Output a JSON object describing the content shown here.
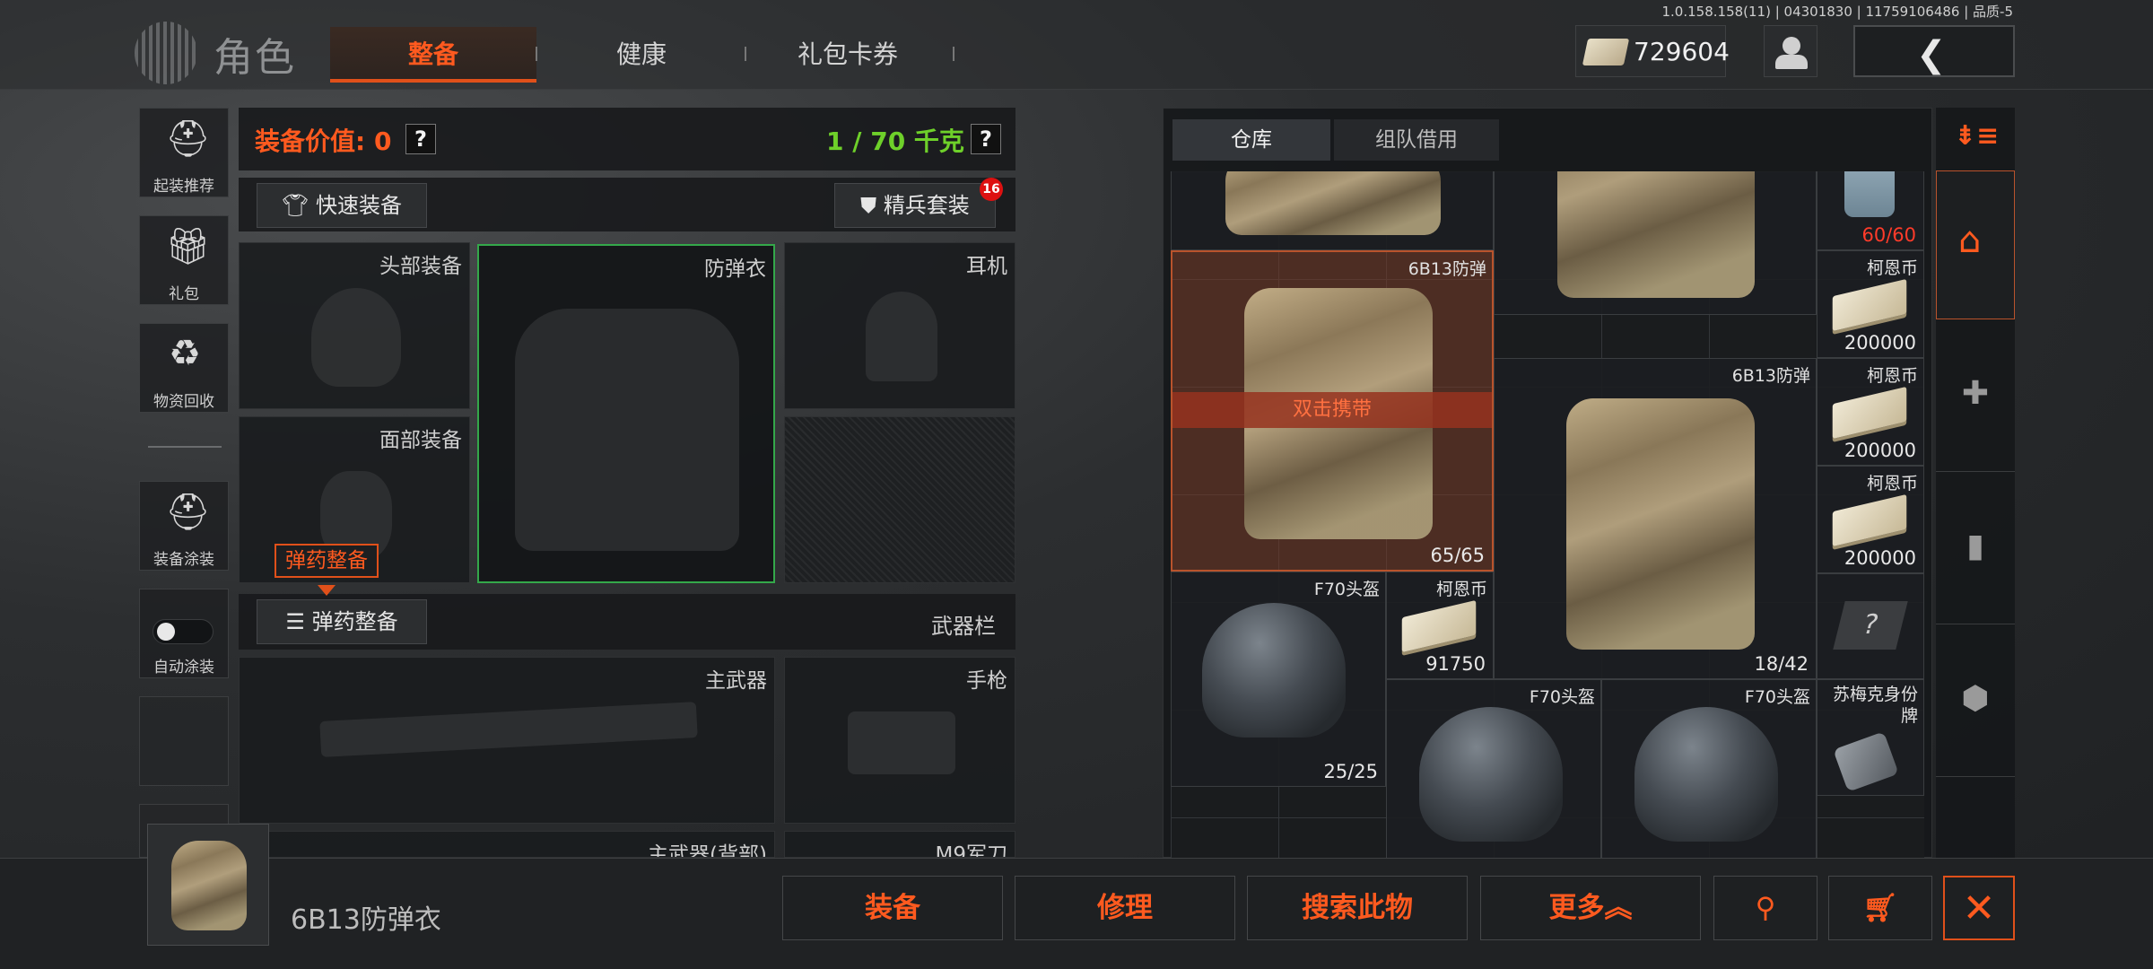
{
  "version": "1.0.158.158(11) | 04301830 | 11759106486 | 品质-5",
  "header": {
    "title": "角色",
    "tabs": [
      "整备",
      "健康",
      "礼包卡券"
    ],
    "currency": "729604"
  },
  "sidebar": {
    "items": [
      {
        "label": "起装推荐",
        "icon": "soldier-preset-icon"
      },
      {
        "label": "礼包",
        "icon": "gift-icon"
      },
      {
        "label": "物资回收",
        "icon": "recycle-icon"
      },
      {
        "label": "装备涂装",
        "icon": "paint-icon"
      },
      {
        "label": "自动涂装",
        "icon": "toggle-icon"
      }
    ]
  },
  "equipment": {
    "value_label": "装备价值: 0",
    "weight": "1 / 70 千克",
    "help": "?",
    "quick_equip": "快速装备",
    "elite_set": "精兵套装",
    "elite_badge": "16",
    "slots": {
      "head": "头部装备",
      "armor": "防弹衣",
      "ear": "耳机",
      "face": "面部装备",
      "main": "主武器",
      "pistol": "手枪",
      "main_back": "主武器(背部)",
      "knife": "M9军刀"
    },
    "ammo_tip": "弹药整备",
    "ammo_button": "弹药整备",
    "weapon_column": "武器栏"
  },
  "storage": {
    "tabs": [
      "仓库",
      "组队借用"
    ],
    "items": {
      "top_can_count": "60/60",
      "armor1_name": "6B13防弹",
      "armor1_tag": "双击携带",
      "armor1_count": "65/65",
      "armor2_name": "6B13防弹",
      "armor2_count": "18/42",
      "money_name": "柯恩币",
      "money_values": [
        "200000",
        "200000",
        "200000"
      ],
      "helmet1_name": "F70头盔",
      "helmet1_count": "25/25",
      "money_small_name": "柯恩币",
      "money_small_value": "91750",
      "helmet2_name": "F70头盔",
      "helmet3_name": "F70头盔",
      "tag_name": "苏梅克身份牌"
    }
  },
  "bottom": {
    "selected_name": "6B13防弹衣",
    "actions": [
      "装备",
      "修理",
      "搜索此物",
      "更多"
    ]
  },
  "colors": {
    "accent": "#ff5a1f",
    "weight_green": "#6ed02a",
    "selected_border": "#34a84a"
  }
}
